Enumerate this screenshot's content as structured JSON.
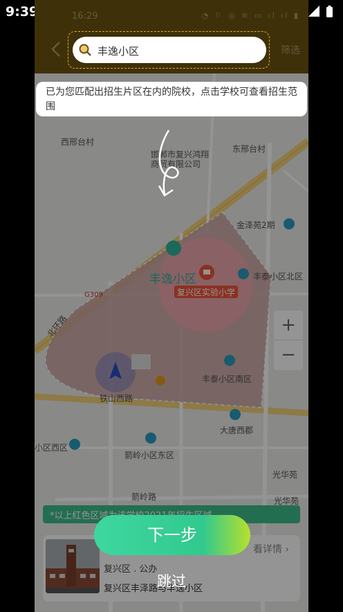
{
  "system": {
    "time": "9:39"
  },
  "header": {
    "inner_time": "16:29",
    "filter_label": "筛选"
  },
  "search": {
    "value": "丰逸小区"
  },
  "tip": {
    "text": "已为您匹配出招生片区在内的院校，点击学校可查看招生范围"
  },
  "map": {
    "labels": {
      "west_xing": "西邢台村",
      "company": "邯郸市复兴鸿翔商贸有限公司",
      "east_xing": "东邢台村",
      "jinze": "金泽苑2期",
      "fengshou_north": "丰泰小区北区",
      "fengyi": "丰逸小区",
      "school": "复兴区实验小学",
      "g309": "G309",
      "beihuan": "北环路",
      "xijie": "西",
      "fengshou_south": "丰泰小区南区",
      "tiehe": "铁山西路",
      "datang": "大唐西郡",
      "xiqu": "小区西区",
      "jianling_east": "箭岭小区东区",
      "guanghua": "光华苑",
      "guanghua2": "光华苑",
      "jianling_road": "箭岭路",
      "lu": "路"
    }
  },
  "zoom": {
    "plus": "+",
    "minus": "−"
  },
  "scope_note": "*以上红色区域为该学校2021年招生区域",
  "card": {
    "detail": "看详情",
    "type": "复兴区 . 公办",
    "address": "复兴区丰泽路与丰逸小区"
  },
  "guide": {
    "next": "下一步",
    "skip": "跳过"
  }
}
